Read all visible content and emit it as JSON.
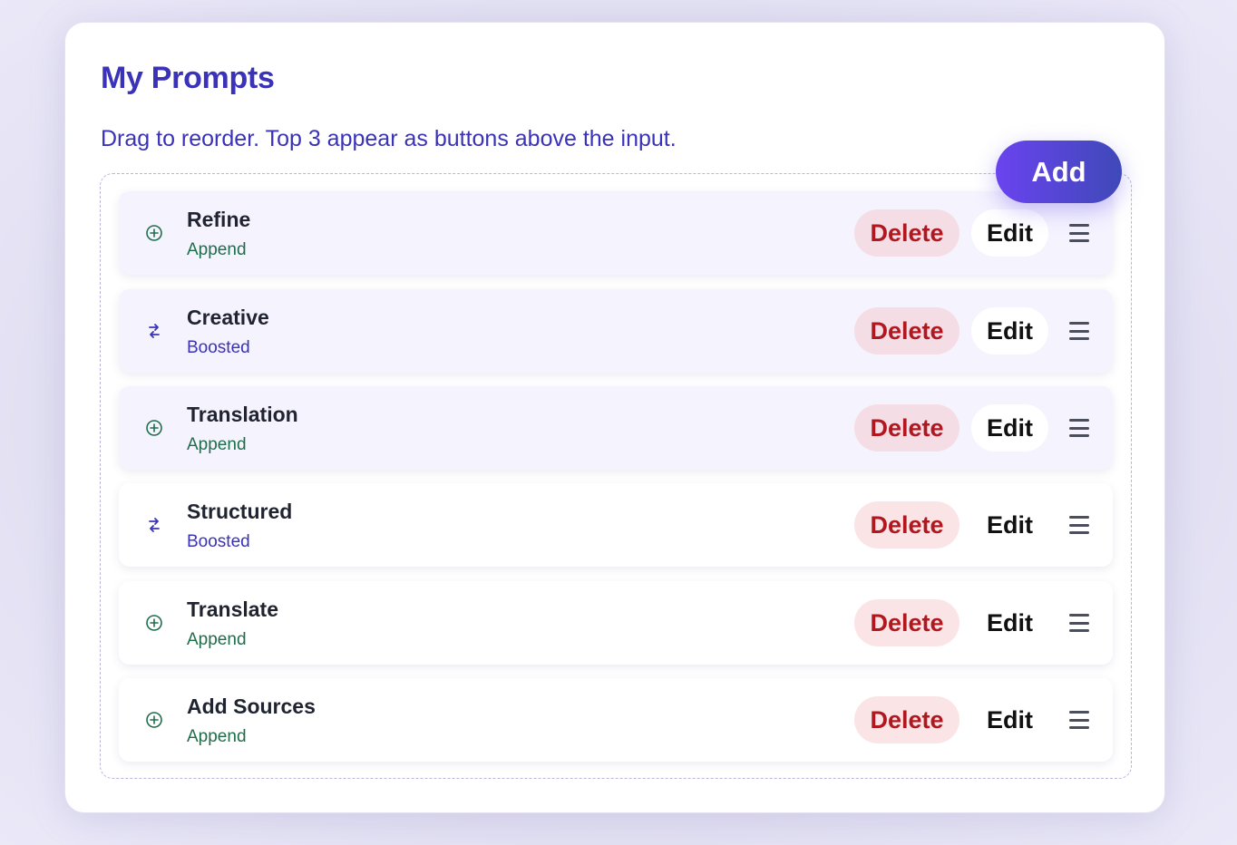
{
  "page": {
    "title": "My Prompts",
    "subtitle": "Drag to reorder. Top 3 appear as buttons above the input.",
    "add_label": "Add"
  },
  "actions": {
    "delete_label": "Delete",
    "edit_label": "Edit"
  },
  "prompts": [
    {
      "name": "Refine",
      "type": "Append",
      "icon": "plus-circle-icon",
      "top": true
    },
    {
      "name": "Creative",
      "type": "Boosted",
      "icon": "swap-arrows-icon",
      "top": true
    },
    {
      "name": "Translation",
      "type": "Append",
      "icon": "plus-circle-icon",
      "top": true
    },
    {
      "name": "Structured",
      "type": "Boosted",
      "icon": "swap-arrows-icon",
      "top": false
    },
    {
      "name": "Translate",
      "type": "Append",
      "icon": "plus-circle-icon",
      "top": false
    },
    {
      "name": "Add Sources",
      "type": "Append",
      "icon": "plus-circle-icon",
      "top": false
    }
  ],
  "colors": {
    "accent": "#3a32b8",
    "append": "#1f6e4a",
    "boosted": "#3a32b8",
    "delete": "#b0171f"
  }
}
